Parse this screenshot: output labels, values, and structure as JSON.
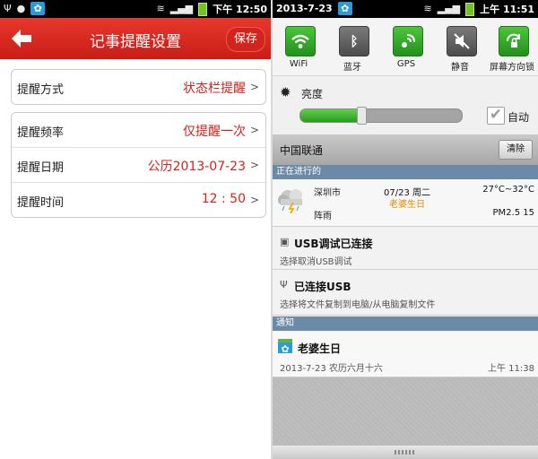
{
  "left": {
    "statusbar": {
      "time": "下午 12:50"
    },
    "title": "记事提醒设置",
    "save_label": "保存",
    "rows": [
      {
        "label": "提醒方式",
        "value": "状态栏提醒"
      },
      {
        "label": "提醒频率",
        "value": "仅提醒一次"
      },
      {
        "label": "提醒日期",
        "value": "公历2013-07-23"
      },
      {
        "label": "提醒时间",
        "value": "12 : 50"
      }
    ]
  },
  "right": {
    "statusbar": {
      "date": "2013-7-23",
      "time": "上午 11:51"
    },
    "quick_settings": [
      {
        "label": "WiFi",
        "icon": "wifi-icon",
        "on": true
      },
      {
        "label": "蓝牙",
        "icon": "bluetooth-icon",
        "on": false
      },
      {
        "label": "GPS",
        "icon": "gps-icon",
        "on": true
      },
      {
        "label": "静音",
        "icon": "mute-icon",
        "on": false
      },
      {
        "label": "屏幕方向锁",
        "icon": "rotation-lock-icon",
        "on": true
      }
    ],
    "brightness": {
      "label": "亮度",
      "auto_label": "自动",
      "level": 0.38,
      "auto_checked": true
    },
    "carrier": "中国联通",
    "clear_label": "清除",
    "ongoing_header": "正在进行的",
    "weather": {
      "city": "深圳市",
      "condition": "阵雨",
      "date": "07/23 周二",
      "event": "老婆生日",
      "temp": "27°C~32°C",
      "pm": "PM2.5  15"
    },
    "usb_debug": {
      "title": "USB调试已连接",
      "sub": "选择取消USB调试"
    },
    "usb_conn": {
      "title": "已连接USB",
      "sub": "选择将文件复制到电脑/从电脑复制文件"
    },
    "notify_header": "通知",
    "birthday": {
      "title": "老婆生日",
      "sub": "2013-7-23 农历六月十六",
      "time": "上午 11:38"
    }
  },
  "colors": {
    "red": "#d0231b",
    "green": "#2a9a1e",
    "section_blue": "#6a8aa8",
    "orange": "#e48a00"
  }
}
